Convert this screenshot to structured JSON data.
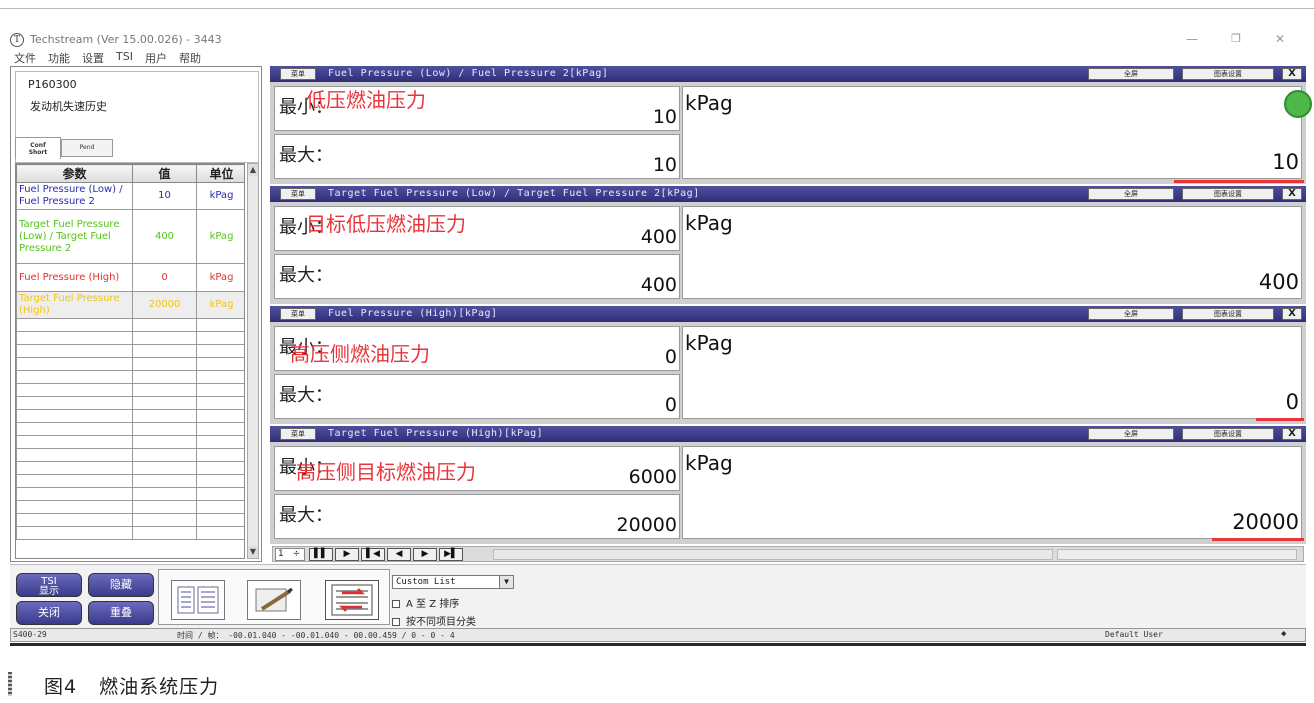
{
  "window": {
    "title": "Techstream (Ver 15.00.026) - 3443",
    "icon_glyph": "T",
    "min_glyph": "—",
    "max_glyph": "❐",
    "close_glyph": "✕"
  },
  "menubar": [
    "文件",
    "功能",
    "设置",
    "TSI",
    "用户",
    "帮助"
  ],
  "left_panel": {
    "dtc_code": "P160300",
    "dtc_desc": "发动机失速历史",
    "tabs": [
      {
        "label_line1": "Conf",
        "label_line2": "Short"
      },
      {
        "label_line1": "Pend",
        "label_line2": ""
      }
    ],
    "table": {
      "headers": [
        "参数",
        "值",
        "单位"
      ],
      "rows": [
        {
          "name": "Fuel Pressure (Low) / Fuel Pressure 2",
          "value": "10",
          "unit": "kPag",
          "color": "#2b2bb0"
        },
        {
          "name": "Target Fuel Pressure (Low) / Target Fuel Pressure 2",
          "value": "400",
          "unit": "kPag",
          "color": "#55c21b"
        },
        {
          "name": "Fuel Pressure (High)",
          "value": "0",
          "unit": "kPag",
          "color": "#e23232"
        },
        {
          "name": "Target Fuel Pressure (High)",
          "value": "20000",
          "unit": "kPag",
          "color": "#f0c419"
        }
      ],
      "empty_rows": 17
    }
  },
  "graphs": {
    "menu_label": "菜单",
    "fullscreen_label": "全屏",
    "settings_label": "图表设置",
    "close_label": "X",
    "min_label": "最小：",
    "max_label": "最大：",
    "panels": [
      {
        "title": "Fuel Pressure (Low) / Fuel Pressure 2[kPag]",
        "min": "10",
        "max": "10",
        "unit": "kPag",
        "value": "10",
        "annotation": "低压燃油压力"
      },
      {
        "title": "Target Fuel Pressure (Low) / Target Fuel Pressure 2[kPag]",
        "min": "400",
        "max": "400",
        "unit": "kPag",
        "value": "400",
        "annotation": "目标低压燃油压力"
      },
      {
        "title": "Fuel Pressure (High)[kPag]",
        "min": "0",
        "max": "0",
        "unit": "kPag",
        "value": "0",
        "annotation": "高压侧燃油压力"
      },
      {
        "title": "Target Fuel Pressure (High)[kPag]",
        "min": "6000",
        "max": "20000",
        "unit": "kPag",
        "value": "20000",
        "annotation": "高压侧目标燃油压力"
      }
    ]
  },
  "playback": {
    "spinner_value": "1",
    "spinner_arrows": "÷",
    "buttons": [
      "▌▌",
      "▶",
      "▌◀",
      "◀",
      "▶",
      "▶▌"
    ]
  },
  "toolbar": {
    "buttons": [
      {
        "line1": "TSI",
        "line2": "显示"
      },
      {
        "line1": "隐藏",
        "line2": ""
      },
      {
        "line1": "关闭",
        "line2": ""
      },
      {
        "line1": "重叠",
        "line2": ""
      }
    ],
    "custom_list": "Custom List",
    "dropdown_glyph": "▼",
    "sort_label": "A 至 Z 排序",
    "group_label": "按不同项目分类"
  },
  "status": {
    "left": "S400-29",
    "time": "时间 / 帧：  -00.01.040 - -00.01.040 - 00.00.459 / 0 - 0 - 4",
    "user": "Default User",
    "end_glyph": "◆"
  },
  "caption": {
    "figure": "图4",
    "text": "燃油系统压力"
  }
}
